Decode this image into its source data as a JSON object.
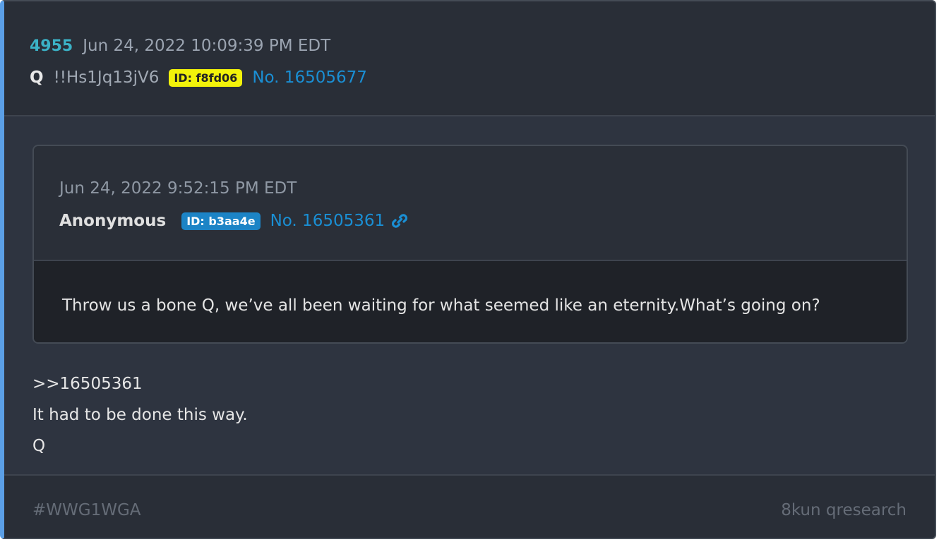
{
  "post": {
    "number": "4955",
    "date": "Jun 24, 2022 10:09:39 PM EDT",
    "author": "Q",
    "tripcode": "!!Hs1Jq13jV6",
    "id_badge": "ID: f8fd06",
    "post_link": "No. 16505677"
  },
  "quoted_post": {
    "date": "Jun 24, 2022 9:52:15 PM EDT",
    "author": "Anonymous",
    "id_badge": "ID: b3aa4e",
    "post_link": "No. 16505361",
    "link_icon": "link-icon",
    "text": "Throw us a bone Q, we’ve all been waiting for what seemed like an eternity.What’s going on?"
  },
  "body": {
    "lines": [
      ">>16505361",
      "It had to be done this way.",
      "Q"
    ]
  },
  "footer": {
    "hashtag": "#WWG1WGA",
    "source": "8kun qresearch"
  },
  "colors": {
    "accent_bar": "#5b9fe6",
    "post_number": "#3bb2c6",
    "link": "#1a8fd4",
    "id_yellow": "#f2f20a",
    "id_blue": "#1c84c6",
    "background": "#2e3440"
  }
}
